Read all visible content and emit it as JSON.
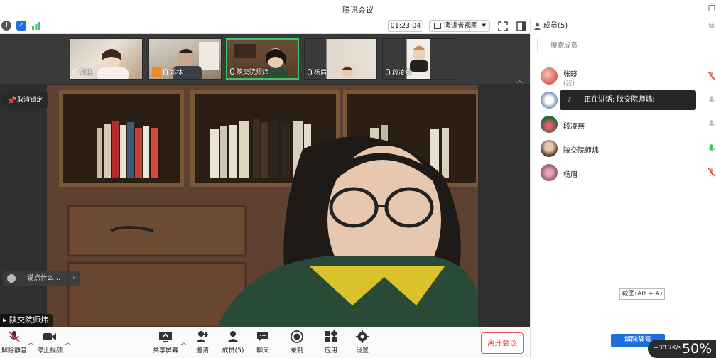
{
  "window": {
    "title": "腾讯会议"
  },
  "status": {
    "timer": "01:23:04",
    "view_mode": "演讲者视图"
  },
  "thumbnails": [
    {
      "name": "张晓"
    },
    {
      "name": "郑林"
    },
    {
      "name": "陕交院师炜"
    },
    {
      "name": "杨眉"
    },
    {
      "name": "段凌燕"
    }
  ],
  "main": {
    "unlock_label": "取消锁定",
    "chat_placeholder": "说点什么...",
    "speaker_name": "陕交院师炜"
  },
  "toolbar": {
    "unmute": "解除静音",
    "stop_video": "停止视频",
    "share_screen": "共享屏幕",
    "invite": "邀请",
    "members": "成员(5)",
    "chat": "聊天",
    "record": "录制",
    "apps": "应用",
    "settings": "设置",
    "leave": "离开会议"
  },
  "panel": {
    "title": "成员(5)",
    "search_placeholder": "搜索成员",
    "members": [
      {
        "name": "张晓",
        "sub": "(我)"
      },
      {
        "name": "",
        "sub": ""
      },
      {
        "name": "段凌燕",
        "sub": ""
      },
      {
        "name": "陕交院师炜",
        "sub": ""
      },
      {
        "name": "杨眉",
        "sub": ""
      }
    ],
    "speaking_tooltip": "正在讲话: 陕交院师炜;",
    "screenshot_hint": "截图(Alt + A)",
    "unmute_all": "解除静音"
  },
  "net": {
    "speed": "+38.7K/s",
    "percent": "50%"
  },
  "colors": {
    "accent": "#1b6fe0",
    "leave": "#e33333",
    "active_speaker": "#3cc46a"
  }
}
